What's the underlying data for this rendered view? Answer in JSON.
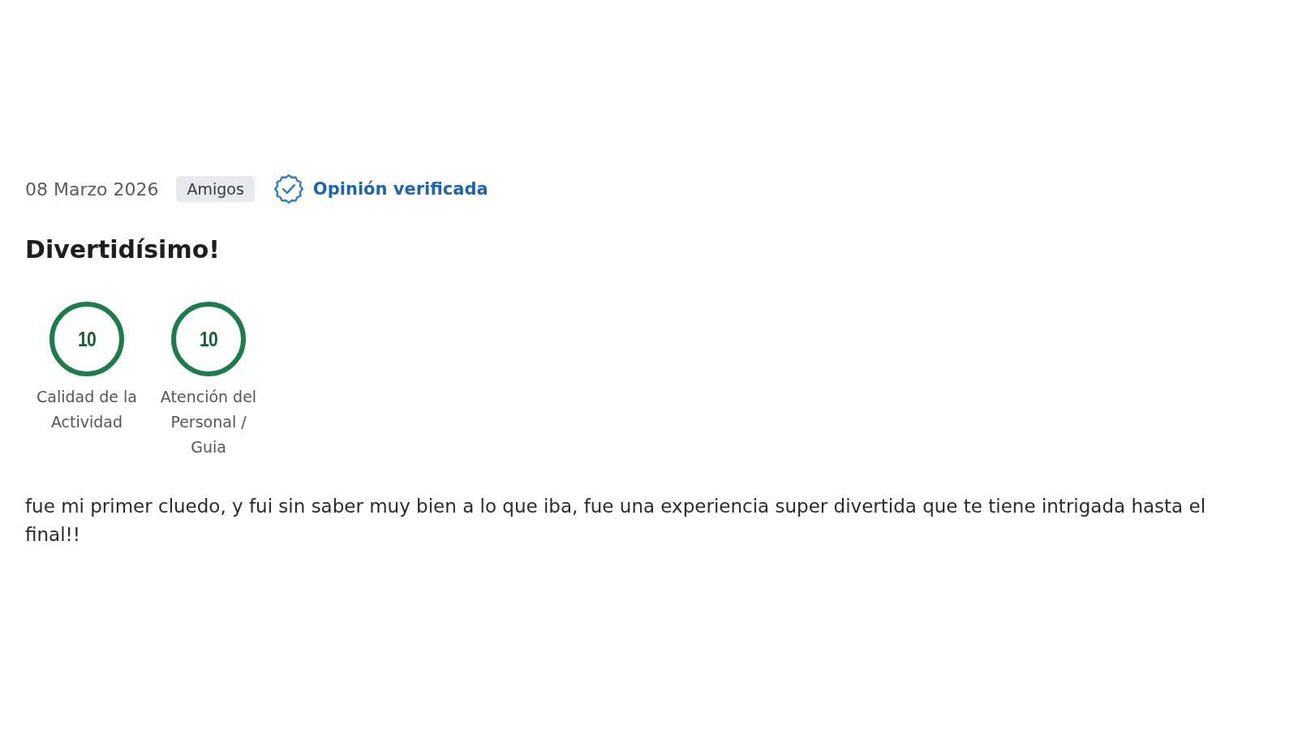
{
  "review": {
    "date": "08 Marzo 2026",
    "tag": "Amigos",
    "verified_label": "Opinión verificada",
    "title": "Divertidísimo!",
    "scores": [
      {
        "value": "10",
        "label": "Calidad de la Actividad"
      },
      {
        "value": "10",
        "label": "Atención del Personal / Guia"
      }
    ],
    "text": "fue mi primer cluedo, y fui sin saber muy bien a lo que iba, fue una experiencia super divertida que te tiene intrigada hasta el final!!"
  }
}
